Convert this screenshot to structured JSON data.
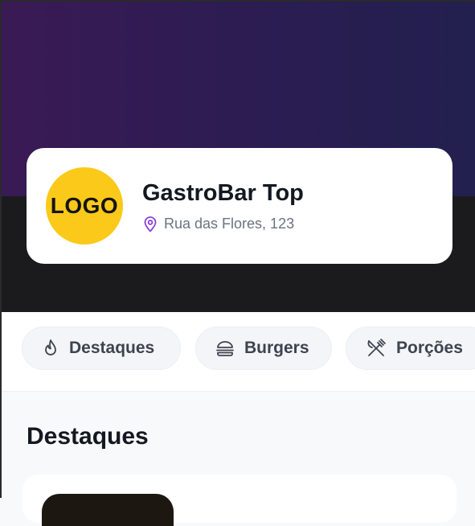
{
  "store": {
    "logo_text": "LOGO",
    "name": "GastroBar Top",
    "address": "Rua das Flores, 123"
  },
  "tabs": [
    {
      "label": "Destaques",
      "icon": "flame-icon"
    },
    {
      "label": "Burgers",
      "icon": "burger-icon"
    },
    {
      "label": "Porções",
      "icon": "utensils-crossed-icon"
    }
  ],
  "section": {
    "title": "Destaques"
  },
  "colors": {
    "hero_start": "#3a1a55",
    "hero_end": "#22204f",
    "logo_bg": "#fbc91a",
    "pin_accent": "#8b3fd6",
    "text_dark": "#141821",
    "text_muted": "#6b7280"
  }
}
